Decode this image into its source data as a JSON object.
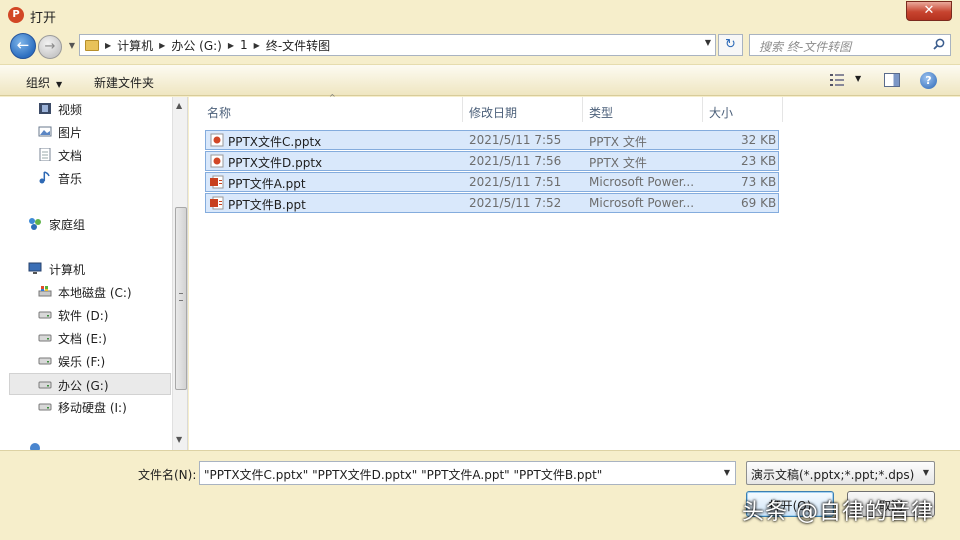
{
  "window": {
    "title": "打开",
    "close_glyph": "✕",
    "app_icon_letter": "P"
  },
  "nav": {
    "back_glyph": "←",
    "forward_glyph": "→",
    "dropdown_glyph": "▼"
  },
  "address": {
    "crumbs": [
      "计算机",
      "办公 (G:)",
      "1",
      "终-文件转图"
    ],
    "separator": "▶",
    "dropdown_glyph": "▼"
  },
  "refresh_glyph": "↻",
  "search": {
    "placeholder": "搜索 终-文件转图"
  },
  "toolbar": {
    "organize_label": "组织",
    "new_folder_label": "新建文件夹",
    "caret": "▼",
    "help_glyph": "?"
  },
  "sidebar": {
    "items": [
      {
        "label": "视频",
        "icon": "video-icon"
      },
      {
        "label": "图片",
        "icon": "picture-icon"
      },
      {
        "label": "文档",
        "icon": "document-icon"
      },
      {
        "label": "音乐",
        "icon": "music-icon"
      },
      {
        "label": "家庭组",
        "icon": "homegroup-icon"
      },
      {
        "label": "计算机",
        "icon": "computer-icon"
      },
      {
        "label": "本地磁盘 (C:)",
        "icon": "system-drive-icon"
      },
      {
        "label": "软件 (D:)",
        "icon": "drive-icon"
      },
      {
        "label": "文档 (E:)",
        "icon": "drive-icon"
      },
      {
        "label": "娱乐 (F:)",
        "icon": "drive-icon"
      },
      {
        "label": "办公 (G:)",
        "icon": "drive-icon",
        "selected": true
      },
      {
        "label": "移动硬盘 (I:)",
        "icon": "drive-icon"
      }
    ],
    "scroll_up": "▲",
    "scroll_down": "▼"
  },
  "columns": {
    "name": "名称",
    "date": "修改日期",
    "type": "类型",
    "size": "大小",
    "sort_glyph": "^"
  },
  "files": [
    {
      "name": "PPTX文件C.pptx",
      "date": "2021/5/11 7:55",
      "type": "PPTX 文件",
      "size": "32 KB",
      "icon": "pptx-icon"
    },
    {
      "name": "PPTX文件D.pptx",
      "date": "2021/5/11 7:56",
      "type": "PPTX 文件",
      "size": "23 KB",
      "icon": "pptx-icon"
    },
    {
      "name": "PPT文件A.ppt",
      "date": "2021/5/11 7:51",
      "type": "Microsoft Power...",
      "size": "73 KB",
      "icon": "ppt-icon"
    },
    {
      "name": "PPT文件B.ppt",
      "date": "2021/5/11 7:52",
      "type": "Microsoft Power...",
      "size": "69 KB",
      "icon": "ppt-icon"
    }
  ],
  "footer": {
    "filename_label": "文件名(N):",
    "filename_value": "\"PPTX文件C.pptx\" \"PPTX文件D.pptx\" \"PPT文件A.ppt\" \"PPT文件B.ppt\"",
    "filetype_value": "演示文稿(*.pptx;*.ppt;*.dps)",
    "dropdown_glyph": "▼",
    "open_label": "打开(O)",
    "cancel_label": "取消"
  },
  "watermark": "头条 @自律的音律",
  "colors": {
    "selection": "#d9e8fb",
    "selection_border": "#84acdd",
    "chrome": "#f6eecb",
    "close": "#c7442f"
  }
}
